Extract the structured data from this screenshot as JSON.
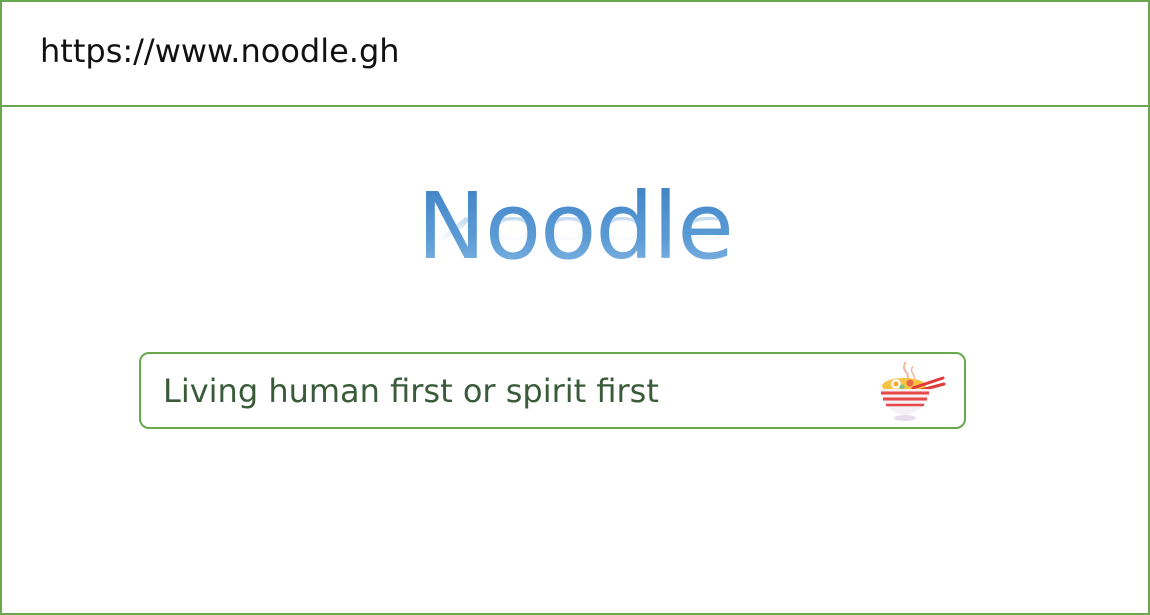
{
  "address_bar": {
    "url": "https://www.noodle.gh"
  },
  "logo": {
    "text": "Noodle"
  },
  "search": {
    "value": "Living human first or spirit first",
    "icon": "noodle-bowl-icon"
  },
  "colors": {
    "border": "#6aa84f",
    "logo": "#5b9bd5",
    "search_text": "#3a5b3a"
  }
}
